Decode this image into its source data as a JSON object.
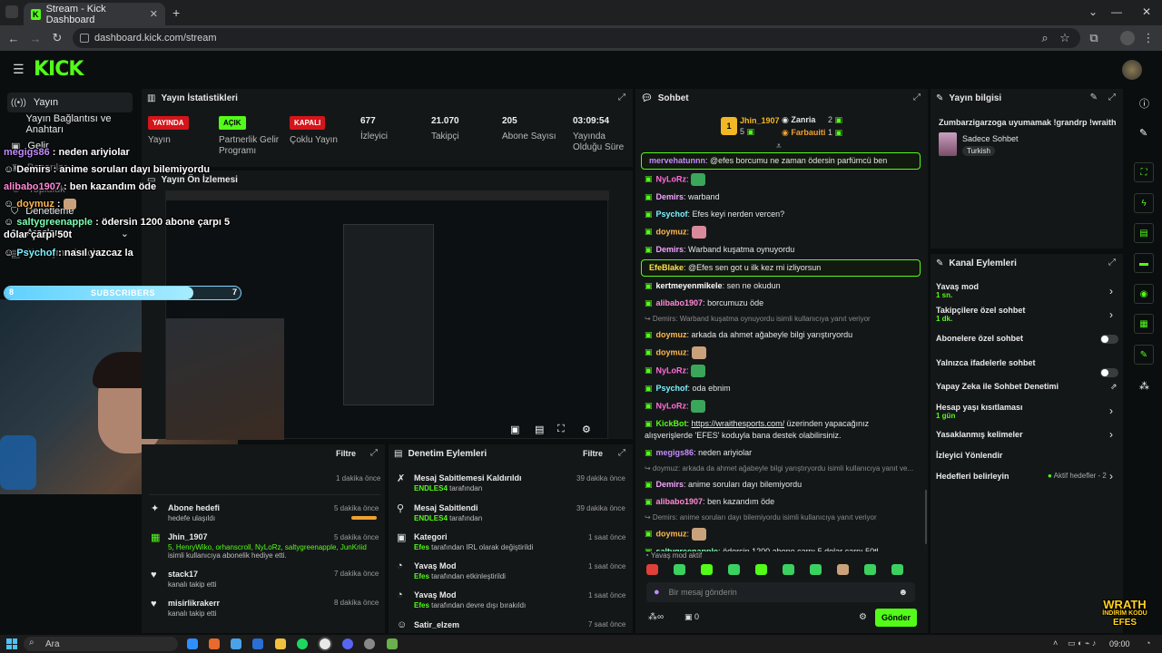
{
  "browser": {
    "tab_title": "Stream - Kick Dashboard",
    "url": "dashboard.kick.com/stream"
  },
  "brand": {
    "logo": "KICK",
    "accent": "#53fc18"
  },
  "sidebar": {
    "items": [
      {
        "label": "Yayın",
        "icon": "broadcast-icon"
      },
      {
        "label": "Yayın Bağlantısı ve Anahtarı",
        "icon": "key-icon"
      },
      {
        "label": "Gelir",
        "icon": "money-icon"
      },
      {
        "label": "Başarılar",
        "icon": "trophy-icon"
      },
      {
        "label": "Topluluk",
        "icon": "users-icon"
      },
      {
        "label": "Denetleme",
        "icon": "shield-icon"
      },
      {
        "label": "Araçlar",
        "icon": "tools-icon"
      },
      {
        "label": "Konuşma Araçları",
        "icon": "chat-tools-icon"
      }
    ]
  },
  "stats": {
    "title": "Yayın İstatistikleri",
    "items": [
      {
        "badge": "YAYINDA",
        "label": "Yayın"
      },
      {
        "badge": "AÇIK",
        "label": "Partnerlik Gelir Programı"
      },
      {
        "badge": "KAPALI",
        "label": "Çoklu Yayın"
      },
      {
        "value": "677",
        "label": "İzleyici"
      },
      {
        "value": "21.070",
        "label": "Takipçi"
      },
      {
        "value": "205",
        "label": "Abone Sayısı"
      },
      {
        "value": "03:09:54",
        "label": "Yayında Olduğu Süre"
      }
    ]
  },
  "preview": {
    "title": "Yayın Ön İzlemesi"
  },
  "overlay_chat": [
    {
      "user": "megigs86",
      "text": "neden ariyiolar",
      "color": "#c38cff"
    },
    {
      "user": "Demirs",
      "text": "anime soruları dayı bilemiyordu",
      "color": "#ffffff"
    },
    {
      "user": "alibabo1907",
      "text": "ben kazandım öde",
      "color": "#ff8ad8"
    },
    {
      "user": "doymuz",
      "text": "",
      "color": "#ffb84d"
    },
    {
      "user": "saltygreenapple",
      "text": "ödersin 1200 abone çarpı 5 dolar çarpı 50t",
      "color": "#7dffb4"
    },
    {
      "user": "Psychof",
      "text": "nasıl yazcaz la",
      "color": "#7df2ff"
    }
  ],
  "subbar": {
    "left": "8",
    "label": "SUBSCRIBERS",
    "right": "7",
    "progress": 0.8
  },
  "activity": {
    "filter": "Filtre",
    "items": [
      {
        "title": "",
        "sub": "",
        "time": "1 dakika önce",
        "icon": "star-icon"
      },
      {
        "title": "Abone hedefi",
        "sub": "hedefe ulaşıldı",
        "time": "5 dakika önce",
        "icon": "sparkle-icon"
      },
      {
        "title": "Jhin_1907",
        "sub": "5, HenryWiko, orhanscroll, NyLoRz, saltygreenapple, JunKriid",
        "sub2": "isimli kullanıcıya abonelik hediye etti.",
        "time": "5 dakika önce",
        "icon": "gift-icon"
      },
      {
        "title": "stack17",
        "sub": "kanalı takip etti",
        "time": "7 dakika önce",
        "icon": "heart-icon"
      },
      {
        "title": "misirlikrakerr",
        "sub": "kanalı takip etti",
        "time": "8 dakika önce",
        "icon": "heart-icon"
      }
    ]
  },
  "moderation": {
    "title": "Denetim Eylemleri",
    "filter": "Filtre",
    "items": [
      {
        "title": "Mesaj Sabitlemesi Kaldırıldı",
        "by": "ENDLES4",
        "suffix": "tarafından",
        "time": "39 dakika önce",
        "icon": "unpin-icon"
      },
      {
        "title": "Mesaj Sabitlendi",
        "by": "ENDLES4",
        "suffix": "tarafından",
        "time": "39 dakika önce",
        "icon": "pin-icon"
      },
      {
        "title": "Kategori",
        "by": "Efes",
        "suffix": "tarafından IRL olarak değiştirildi",
        "time": "1 saat önce",
        "icon": "category-icon"
      },
      {
        "title": "Yavaş Mod",
        "by": "Efes",
        "suffix": "tarafından etkinleştirildi",
        "time": "1 saat önce",
        "icon": "slow-icon"
      },
      {
        "title": "Yavaş Mod",
        "by": "Efes",
        "suffix": "tarafından devre dışı bırakıldı",
        "time": "1 saat önce",
        "icon": "slow-icon"
      },
      {
        "title": "Satir_elzem",
        "by": "",
        "suffix": "",
        "time": "7 saat önce",
        "icon": "user-icon"
      }
    ]
  },
  "chat": {
    "title": "Sohbet",
    "leaders": [
      {
        "name": "Jhin_1907",
        "count": "5"
      },
      {
        "name": "Zanria",
        "count": "2"
      },
      {
        "name": "Farbauiti",
        "count": "1"
      }
    ],
    "messages": [
      {
        "user": "mervehatunnn",
        "color": "#c38cff",
        "text": "@efes borcumu ne zaman ödersin parfümcü ben",
        "highlight": true
      },
      {
        "user": "NyLoRz",
        "color": "#ff6fd8",
        "text": "",
        "emote": "#3aa65a"
      },
      {
        "user": "Demirs",
        "color": "#f5a3ff",
        "text": "warband"
      },
      {
        "user": "Psychof",
        "color": "#7df2ff",
        "text": "Efes keyi nerden vercen?"
      },
      {
        "user": "doymuz",
        "color": "#ffb84d",
        "text": "",
        "emote": "#d88a9b"
      },
      {
        "user": "Demirs",
        "color": "#f5a3ff",
        "text": "Warband kuşatma oynuyordu"
      },
      {
        "user": "EfeBlake",
        "color": "#ffe14d",
        "text": "@Efes sen got u ilk kez mi izliyorsun",
        "highlight": true
      },
      {
        "user": "kertmeyenmikele",
        "color": "#ffffff",
        "text": "sen ne okudun"
      },
      {
        "user": "alibabo1907",
        "color": "#ff8ad8",
        "text": "borcumuzu öde"
      },
      {
        "reply": "Demirs: Warband kuşatma oynuyordu isimli kullanıcıya yanıt veriyor"
      },
      {
        "user": "doymuz",
        "color": "#ffb84d",
        "text": "arkada da ahmet ağabeyle bilgi yarıştıryordu"
      },
      {
        "user": "doymuz",
        "color": "#ffb84d",
        "text": "",
        "emote": "#c9a27c"
      },
      {
        "user": "NyLoRz",
        "color": "#ff6fd8",
        "text": "",
        "emote": "#3aa65a"
      },
      {
        "user": "Psychof",
        "color": "#7df2ff",
        "text": "oda ebnim"
      },
      {
        "user": "NyLoRz",
        "color": "#ff6fd8",
        "text": "",
        "emote": "#3aa65a"
      },
      {
        "user": "KickBot",
        "color": "#53fc18",
        "text": "https://wraithesports.com/ üzerinden yapacağınız alışverişlerde 'EFES' koduyla bana destek olabilirsiniz."
      },
      {
        "user": "megigs86",
        "color": "#c38cff",
        "text": "neden ariyiolar"
      },
      {
        "reply": "doymuz: arkada da ahmet ağabeyle bilgi yarıştıryordu isimli kullanıcıya yanıt ve..."
      },
      {
        "user": "Demirs",
        "color": "#f5a3ff",
        "text": "anime soruları dayı bilemiyordu"
      },
      {
        "user": "alibabo1907",
        "color": "#ff8ad8",
        "text": "ben kazandım öde"
      },
      {
        "reply": "Demirs: anime soruları dayı bilemiyordu isimli kullanıcıya yanıt veriyor"
      },
      {
        "user": "doymuz",
        "color": "#ffb84d",
        "text": "",
        "emote": "#c9a27c"
      },
      {
        "user": "saltygreenapple",
        "color": "#7dffb4",
        "text": "ödersin 1200 abone çarpı 5 dolar çarpı 50tl"
      },
      {
        "user": "Psychof",
        "color": "#7df2ff",
        "text": "nasıl yazcaz la"
      }
    ],
    "slow_mode": "Yavaş mod aktif",
    "placeholder": "Bir mesaj gönderin",
    "points": "0",
    "send": "Gönder"
  },
  "stream_info": {
    "title": "Yayın bilgisi",
    "stream_title": "Zumbarzigarzoga uyumamak !grandrp !wraith",
    "category": "Sadece Sohbet",
    "tag": "Turkish"
  },
  "channel_actions": {
    "title": "Kanal Eylemleri",
    "items": [
      {
        "label": "Yavaş mod",
        "sub": "1 sn.",
        "type": "arrow"
      },
      {
        "label": "Takipçilere özel sohbet",
        "sub": "1 dk.",
        "type": "arrow"
      },
      {
        "label": "Abonelere özel sohbet",
        "sub": "",
        "type": "toggle"
      },
      {
        "label": "Yalnızca ifadelerle sohbet",
        "sub": "",
        "type": "toggle"
      },
      {
        "label": "Yapay Zeka ile Sohbet Denetimi",
        "sub": "",
        "type": "external"
      },
      {
        "label": "Hesap yaşı kısıtlaması",
        "sub": "1 gün",
        "type": "arrow"
      },
      {
        "label": "Yasaklanmış kelimeler",
        "sub": "",
        "type": "arrow"
      },
      {
        "label": "İzleyici Yönlendir",
        "sub": "",
        "type": "none"
      },
      {
        "label": "Hedefleri belirleyin",
        "sub": "",
        "type": "goals",
        "extra": "Aktif hedefler - 2"
      }
    ]
  },
  "watermark": {
    "line1": "WRATH",
    "line2": "İNDİRİM KODU",
    "line3": "EFES"
  },
  "taskbar": {
    "search": "Ara",
    "time": "09:00"
  }
}
